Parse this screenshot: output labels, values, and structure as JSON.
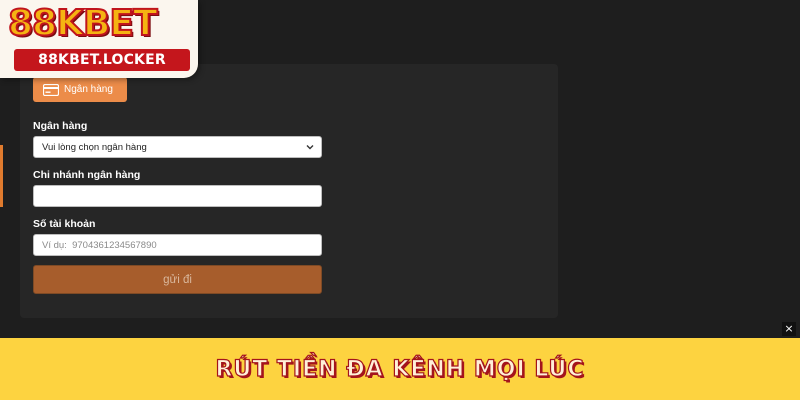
{
  "logo": {
    "brand": "88KBET",
    "domain": "88KBET.LOCKER"
  },
  "withdraw": {
    "method_tab": {
      "label": "Ngân hàng",
      "icon": "bank-card-icon"
    },
    "fields": {
      "bank": {
        "label": "Ngân hàng",
        "selected": "Vui lòng chọn ngân hàng"
      },
      "branch": {
        "label": "Chi nhánh ngân hàng",
        "value": ""
      },
      "account": {
        "label": "Số tài khoản",
        "placeholder": "Ví dụ:  9704361234567890"
      }
    },
    "submit_label": "gửi đi"
  },
  "banner": {
    "text": "RÚT TIỀN ĐA KÊNH MỌI LÚC"
  },
  "close_label": "×",
  "colors": {
    "accent": "#ec8c49",
    "submit": "#a75d2c",
    "banner": "#fdd340",
    "brand_red": "#c4161c"
  }
}
